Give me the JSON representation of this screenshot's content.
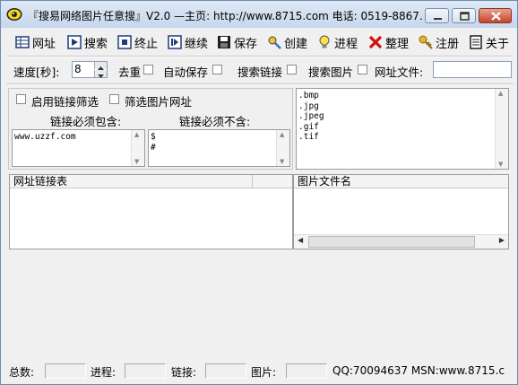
{
  "window": {
    "title": "『搜易网络图片任意搜』V2.0 —主页: http://www.8715.com 电话: 0519-8867..."
  },
  "toolbar": {
    "url": "网址",
    "search": "搜索",
    "stop": "终止",
    "continue": "继续",
    "save": "保存",
    "create": "创建",
    "process": "进程",
    "tidy": "整理",
    "register": "注册",
    "about": "关于"
  },
  "options": {
    "speed_label": "速度[秒]:",
    "speed_value": "8",
    "dedupe_label": "去重",
    "autosave_label": "自动保存",
    "search_links_label": "搜索链接",
    "search_images_label": "搜索图片",
    "url_file_label": "网址文件:",
    "url_file_value": ""
  },
  "filters": {
    "enable_link_filter": "启用链接筛选",
    "filter_image_urls": "筛选图片网址",
    "must_contain_label": "链接必须包含:",
    "must_not_contain_label": "链接必须不含:",
    "must_contain_text": "www.uzzf.com",
    "must_not_contain_text": "$\n#",
    "extensions_text": ".bmp\n.jpg\n.jpeg\n.gif\n.tif"
  },
  "tables": {
    "links_header": "网址链接表",
    "images_header": "图片文件名"
  },
  "status": {
    "total": "总数:",
    "progress": "进程:",
    "links": "链接:",
    "images": "图片:",
    "contact": "QQ:70094637 MSN:www.8715.c"
  }
}
